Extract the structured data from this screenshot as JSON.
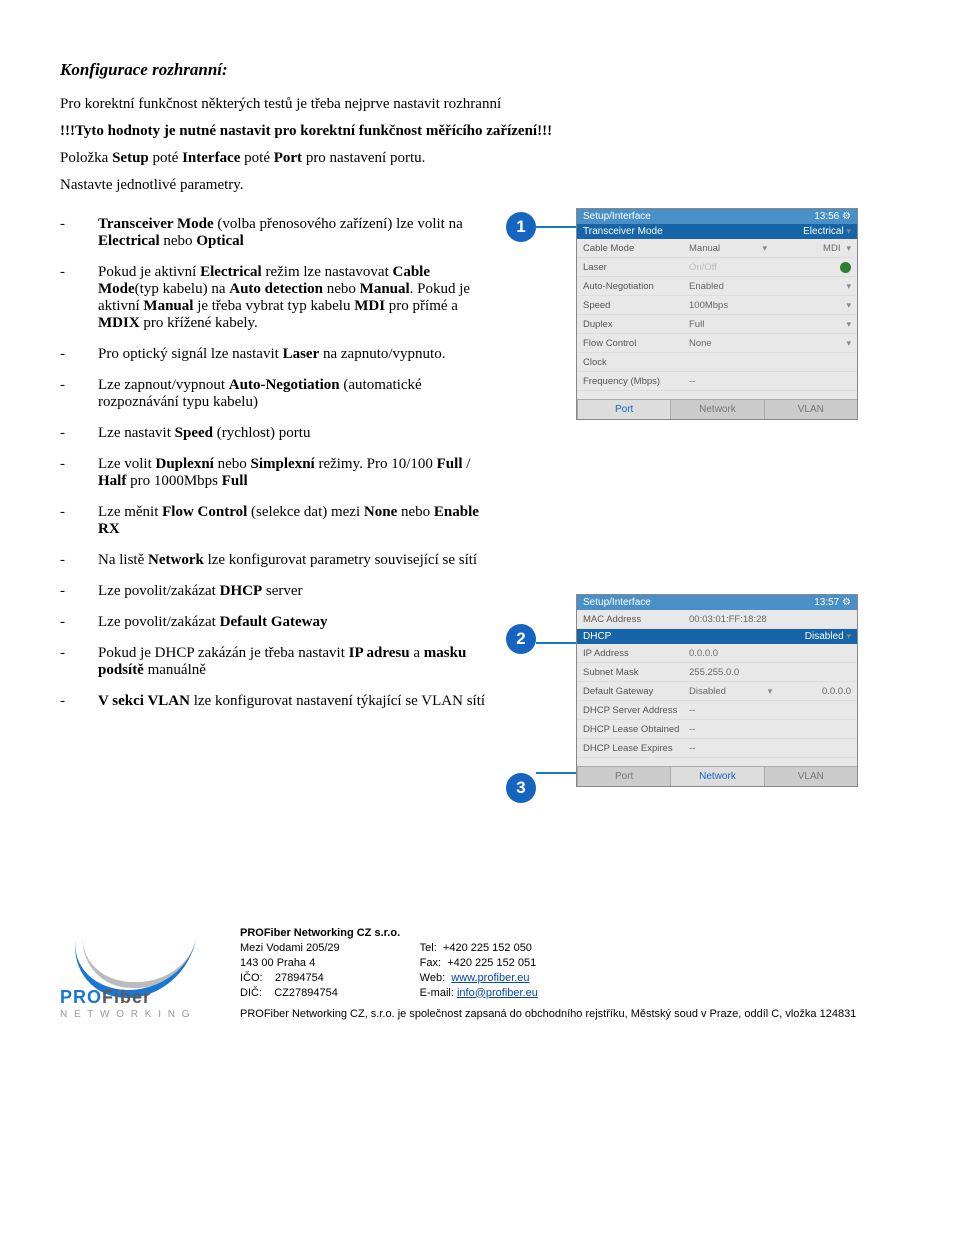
{
  "heading": "Konfigurace rozhranní:",
  "intro1": "Pro korektní funkčnost některých testů je třeba nejprve nastavit rozhranní",
  "intro2_a": "!!!Tyto hodnoty je nutné nastavit pro korektní funkčnost měřícího zařízení!!!",
  "intro3_a": " Položka ",
  "intro3_b": "Setup",
  "intro3_c": " poté ",
  "intro3_d": "Interface",
  "intro3_e": " poté ",
  "intro3_f": "Port",
  "intro3_g": " pro nastavení portu.",
  "intro4": "Nastavte jednotlivé parametry.",
  "bullets": [
    {
      "dash": "-",
      "pre": "",
      "b1": "Transceiver Mode",
      "mid1": " (volba přenosového zařízení) lze volit na ",
      "b2": "Electrical",
      "mid2": " nebo ",
      "b3": "Optical",
      "tail": ""
    },
    {
      "dash": "-",
      "pre": "Pokud je aktivní ",
      "b1": "Electrical",
      "mid1": " režim lze nastavovat ",
      "b2": "Cable Mode",
      "mid2": "(typ kabelu) na ",
      "b3": "Auto detection",
      "tail": " nebo ",
      "b4": "Manual",
      "tail2": ". Pokud je aktivní ",
      "b5": "Manual",
      "tail3": " je třeba vybrat typ kabelu ",
      "b6": "MDI",
      "tail4": " pro přímé a ",
      "b7": "MDIX",
      "tail5": " pro křížené kabely."
    },
    {
      "dash": "-",
      "pre": "Pro optický signál lze nastavit ",
      "b1": "Laser",
      "tail": " na zapnuto/vypnuto."
    },
    {
      "dash": "-",
      "pre": "Lze zapnout/vypnout ",
      "b1": "Auto-Negotiation",
      "tail": " (automatické rozpoznávání typu kabelu)"
    },
    {
      "dash": "-",
      "pre": "Lze nastavit ",
      "b1": "Speed",
      "tail": " (rychlost) portu"
    },
    {
      "dash": "-",
      "pre": "Lze volit ",
      "b1": "Duplexní",
      "mid1": " nebo ",
      "b2": "Simplexní",
      "tail": " režimy. Pro 10/100 ",
      "b3": "Full",
      "mid2": " / ",
      "b4": "Half",
      "tail2": " pro 1000Mbps ",
      "b5": "Full"
    },
    {
      "dash": "-",
      "pre": "Lze měnit ",
      "b1": "Flow Control",
      "mid1": " (selekce dat) mezi ",
      "b2": "None",
      "mid2": " nebo ",
      "b3": "Enable RX",
      "tail": ""
    },
    {
      "dash": "-",
      "pre": "Na listě ",
      "b1": "Network",
      "tail": " lze konfigurovat parametry související se sítí"
    },
    {
      "dash": "-",
      "pre": "Lze povolit/zakázat ",
      "b1": "DHCP",
      "tail": " server"
    },
    {
      "dash": "-",
      "pre": "Lze povolit/zakázat ",
      "b1": "Default Gateway",
      "tail": ""
    },
    {
      "dash": "-",
      "pre": "Pokud je DHCP zakázán je třeba nastavit ",
      "b1": "IP adresu",
      "mid1": " a ",
      "b2": "masku podsítě",
      "tail": " manuálně"
    },
    {
      "dash": "-",
      "pre": "",
      "b1": "V sekci VLAN",
      "tail": " lze konfigurovat nastavení týkající se VLAN sítí"
    }
  ],
  "panel1": {
    "title": "Setup/Interface",
    "time": "13:56 ⚙",
    "headerL": "Transceiver Mode",
    "headerR": "Electrical",
    "rows": [
      {
        "label": "Cable Mode",
        "v1": "Manual",
        "v2": "MDI"
      },
      {
        "label": "Laser",
        "v1": "On/Off",
        "toggle": true,
        "disabled": true
      },
      {
        "label": "Auto-Negotiation",
        "v1": "Enabled"
      },
      {
        "label": "Speed",
        "v1": "100Mbps"
      },
      {
        "label": "Duplex",
        "v1": "Full"
      },
      {
        "label": "Flow Control",
        "v1": "None"
      },
      {
        "label": "Clock",
        "v1": "",
        "disabled": true
      },
      {
        "label": "Frequency (Mbps)",
        "v1": "--"
      }
    ],
    "tabs": [
      "Port",
      "Network",
      "VLAN"
    ],
    "activeTab": 0
  },
  "panel2": {
    "title": "Setup/Interface",
    "time": "13:57 ⚙",
    "rows": [
      {
        "label": "MAC Address",
        "v1": "00:03:01:FF:18:28"
      }
    ],
    "headerL": "DHCP",
    "headerR": "Disabled",
    "rows2": [
      {
        "label": "IP Address",
        "v1": "0.0.0.0"
      },
      {
        "label": "Subnet Mask",
        "v1": "255.255.0.0"
      },
      {
        "label": "Default Gateway",
        "v1": "Disabled",
        "v2": "0.0.0.0"
      },
      {
        "label": "DHCP Server Address",
        "v1": "--"
      },
      {
        "label": "DHCP Lease Obtained",
        "v1": "--"
      },
      {
        "label": "DHCP Lease Expires",
        "v1": "--"
      }
    ],
    "tabs": [
      "Port",
      "Network",
      "VLAN"
    ],
    "activeTab": 1
  },
  "callouts": {
    "c1": "1",
    "c2": "2",
    "c3": "3"
  },
  "footer": {
    "company": "PROFiber Networking CZ  s.r.o.",
    "addr1": "Mezi Vodami 205/29",
    "addr2": "143 00 Praha 4",
    "ico_l": "IČO:",
    "ico": "27894754",
    "dic_l": "DIČ:",
    "dic": "CZ27894754",
    "tel_l": "Tel:",
    "tel": "+420 225 152 050",
    "fax_l": "Fax:",
    "fax": "+420 225 152 051",
    "web_l": "Web:",
    "web": "www.profiber.eu",
    "mail_l": "E-mail:",
    "mail": "info@profiber.eu",
    "note": "PROFiber Networking CZ, s.r.o. je společnost zapsaná do obchodního rejstříku, Městský soud v Praze, oddíl C, vložka 124831",
    "logo1": "PRO",
    "logo2": "Fiber",
    "logo3": "N E T W O R K I N G"
  }
}
